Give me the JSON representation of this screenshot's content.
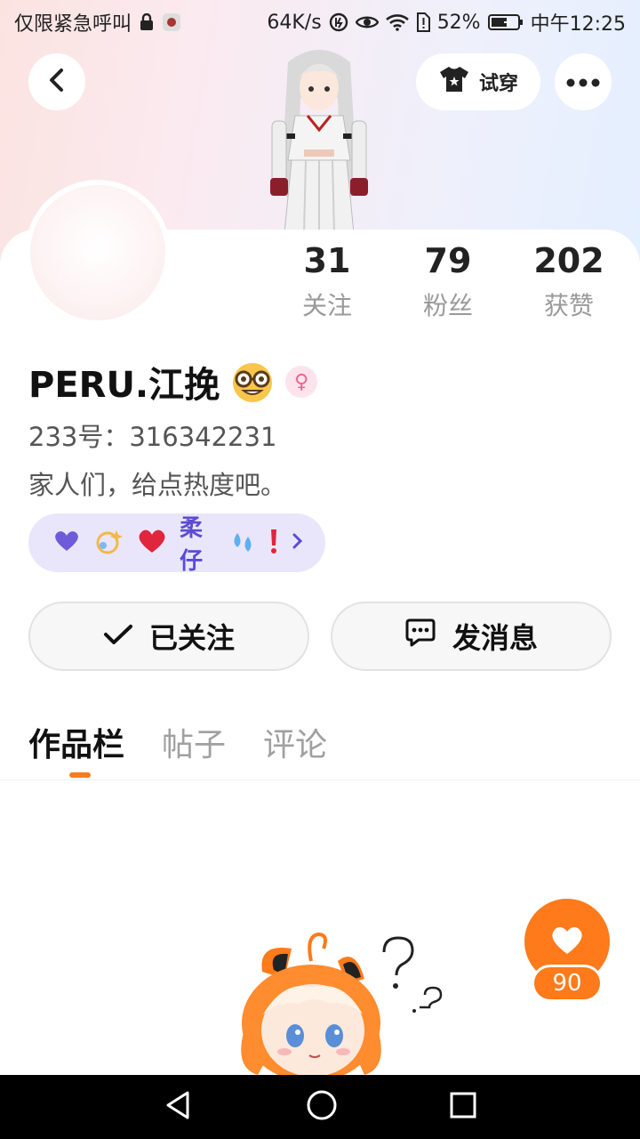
{
  "status_bar": {
    "carrier": "仅限紧急呼叫",
    "speed": "64K/s",
    "battery": "52%",
    "time": "中午12:25"
  },
  "header": {
    "tryon_label": "试穿"
  },
  "stats": [
    {
      "value": "31",
      "label": "关注"
    },
    {
      "value": "79",
      "label": "粉丝"
    },
    {
      "value": "202",
      "label": "获赞"
    }
  ],
  "profile": {
    "username": "PERU.江挽",
    "user_id": "233号：316342231",
    "bio": "家人们，给点热度吧。",
    "gender": "female"
  },
  "family": {
    "name": "柔仔"
  },
  "actions": {
    "follow_label": "已关注",
    "message_label": "发消息"
  },
  "tabs": [
    {
      "label": "作品栏",
      "active": true
    },
    {
      "label": "帖子",
      "active": false
    },
    {
      "label": "评论",
      "active": false
    }
  ],
  "like": {
    "count": "90"
  },
  "colors": {
    "accent": "#ff7a1a",
    "family_text": "#5b4bd6",
    "family_bg": "#e9e6fb"
  }
}
